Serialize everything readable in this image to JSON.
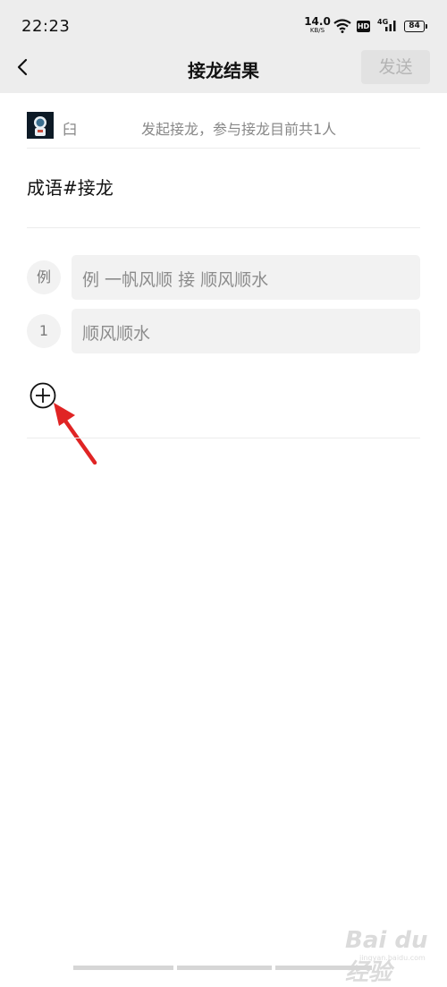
{
  "status_bar": {
    "time": "22:23",
    "net_speed": "14.0",
    "net_unit": "KB/S",
    "hd": "HD",
    "network": "4G",
    "battery": "84"
  },
  "header": {
    "title": "接龙结果",
    "send_label": "发送"
  },
  "info": {
    "owner": "⾅",
    "description": "发起接龙，参与接龙目前共1人"
  },
  "topic": "成语#接龙",
  "entries": [
    {
      "index": "例",
      "text": "例 一帆风顺 接 顺风顺水"
    },
    {
      "index": "1",
      "text": "顺风顺水"
    }
  ],
  "watermark": {
    "text": "Bai du 经验",
    "url": "jingyan.baidu.com"
  },
  "colors": {
    "header_bg": "#ededed",
    "send_disabled_bg": "#e2e2e2",
    "field_bg": "#f2f2f2",
    "annotation_arrow": "#e02424"
  },
  "icons": {
    "back": "chevron-left-icon",
    "add": "plus-circle-icon",
    "annotation": "red-arrow-icon"
  }
}
